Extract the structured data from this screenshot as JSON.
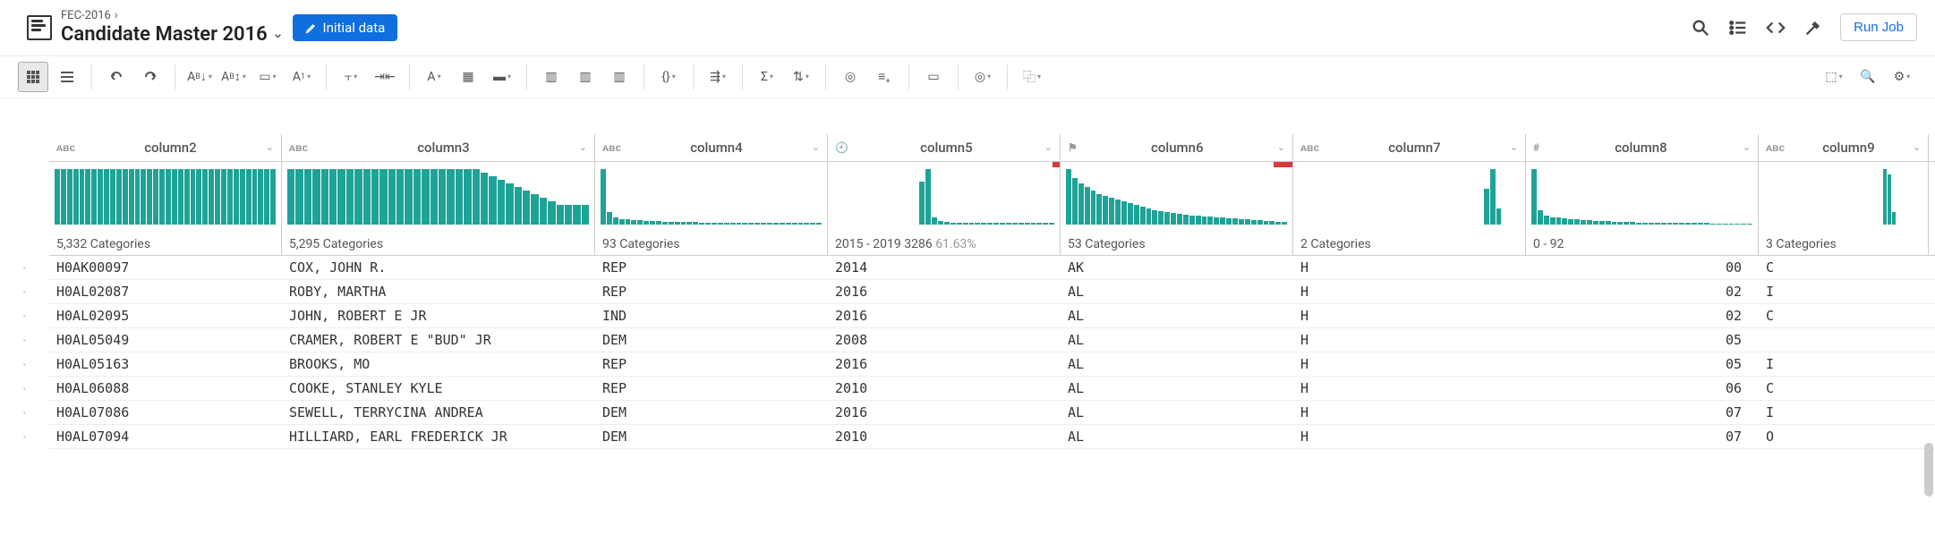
{
  "breadcrumb": {
    "parent": "FEC-2016",
    "title": "Candidate Master 2016"
  },
  "badge": {
    "label": "Initial data"
  },
  "runjob": {
    "label": "Run Job"
  },
  "columns": [
    {
      "key": "c2",
      "name": "column2",
      "type": "ABC",
      "summary": "5,332 Categories"
    },
    {
      "key": "c3",
      "name": "column3",
      "type": "ABC",
      "summary": "5,295 Categories"
    },
    {
      "key": "c4",
      "name": "column4",
      "type": "ABC",
      "summary": "93 Categories"
    },
    {
      "key": "c5",
      "name": "column5",
      "type": "TIME",
      "summary": "2015 - 2019  3286",
      "pct": "61.63%"
    },
    {
      "key": "c6",
      "name": "column6",
      "type": "FLAG",
      "summary": "53 Categories"
    },
    {
      "key": "c7",
      "name": "column7",
      "type": "ABC",
      "summary": "2 Categories"
    },
    {
      "key": "c8",
      "name": "column8",
      "type": "NUM",
      "summary": "0 - 92"
    },
    {
      "key": "c9",
      "name": "column9",
      "type": "ABC",
      "summary": "3 Categories"
    }
  ],
  "rows": [
    {
      "c2": "H0AK00097",
      "c3": "COX, JOHN R.",
      "c4": "REP",
      "c5": "2014",
      "c6": "AK",
      "c7": "H",
      "c8": "00",
      "c9": "C"
    },
    {
      "c2": "H0AL02087",
      "c3": "ROBY, MARTHA",
      "c4": "REP",
      "c5": "2016",
      "c6": "AL",
      "c7": "H",
      "c8": "02",
      "c9": "I"
    },
    {
      "c2": "H0AL02095",
      "c3": "JOHN, ROBERT E JR",
      "c4": "IND",
      "c5": "2016",
      "c6": "AL",
      "c7": "H",
      "c8": "02",
      "c9": "C"
    },
    {
      "c2": "H0AL05049",
      "c3": "CRAMER, ROBERT E \"BUD\" JR",
      "c4": "DEM",
      "c5": "2008",
      "c6": "AL",
      "c7": "H",
      "c8": "05",
      "c9": ""
    },
    {
      "c2": "H0AL05163",
      "c3": "BROOKS, MO",
      "c4": "REP",
      "c5": "2016",
      "c6": "AL",
      "c7": "H",
      "c8": "05",
      "c9": "I"
    },
    {
      "c2": "H0AL06088",
      "c3": "COOKE, STANLEY KYLE",
      "c4": "REP",
      "c5": "2010",
      "c6": "AL",
      "c7": "H",
      "c8": "06",
      "c9": "C"
    },
    {
      "c2": "H0AL07086",
      "c3": "SEWELL, TERRYCINA ANDREA",
      "c4": "DEM",
      "c5": "2016",
      "c6": "AL",
      "c7": "H",
      "c8": "07",
      "c9": "I"
    },
    {
      "c2": "H0AL07094",
      "c3": "HILLIARD, EARL FREDERICK JR",
      "c4": "DEM",
      "c5": "2010",
      "c6": "AL",
      "c7": "H",
      "c8": "07",
      "c9": "O"
    }
  ],
  "chart_data": [
    {
      "column": "column2",
      "type": "bar",
      "note": "histogram of 5332 categories, roughly uniform",
      "values": [
        62,
        62,
        62,
        62,
        62,
        62,
        62,
        62,
        62,
        62,
        62,
        62,
        62,
        62,
        62,
        62,
        62,
        62,
        62,
        62,
        62,
        62,
        62,
        62,
        62,
        62,
        62,
        62,
        62,
        62,
        62,
        62,
        62,
        62,
        62,
        62
      ]
    },
    {
      "column": "column3",
      "type": "bar",
      "note": "histogram of 5295 categories, mostly uniform then tapering",
      "values": [
        62,
        62,
        62,
        62,
        62,
        62,
        62,
        62,
        62,
        62,
        62,
        62,
        62,
        62,
        62,
        62,
        62,
        62,
        62,
        62,
        62,
        62,
        62,
        58,
        54,
        50,
        46,
        42,
        38,
        34,
        30,
        26,
        22,
        22,
        22,
        22
      ]
    },
    {
      "column": "column4",
      "type": "bar",
      "note": "93 categories, one dominant then long tail",
      "values": [
        62,
        14,
        8,
        6,
        6,
        5,
        5,
        4,
        4,
        4,
        3,
        3,
        3,
        3,
        3,
        3,
        2,
        2,
        2,
        2,
        2,
        2,
        2,
        2,
        2,
        2,
        2,
        2,
        2,
        2,
        2,
        2,
        2,
        2,
        2,
        2
      ]
    },
    {
      "column": "column5",
      "type": "bar",
      "note": "years 2015-2019, two tall bars with small red invalid segment on right",
      "values": [
        0,
        0,
        0,
        0,
        0,
        0,
        0,
        0,
        0,
        0,
        0,
        0,
        0,
        0,
        48,
        62,
        8,
        4,
        3,
        2,
        2,
        2,
        2,
        2,
        2,
        2,
        2,
        2,
        2,
        2,
        2,
        2,
        2,
        2,
        2,
        2
      ],
      "invalid_fraction": 0.03
    },
    {
      "column": "column6",
      "type": "bar",
      "note": "53 categories descending with red invalid on right",
      "values": [
        62,
        52,
        46,
        42,
        38,
        34,
        32,
        30,
        28,
        26,
        24,
        22,
        20,
        18,
        16,
        15,
        14,
        13,
        12,
        11,
        10,
        10,
        9,
        9,
        8,
        8,
        7,
        7,
        6,
        6,
        5,
        5,
        4,
        4,
        3,
        3
      ],
      "invalid_fraction": 0.08
    },
    {
      "column": "column7",
      "type": "bar",
      "note": "2 categories",
      "values": [
        0,
        0,
        0,
        0,
        0,
        0,
        0,
        0,
        0,
        0,
        0,
        0,
        0,
        0,
        0,
        0,
        0,
        0,
        0,
        0,
        0,
        0,
        0,
        0,
        0,
        0,
        0,
        0,
        0,
        0,
        40,
        62,
        18,
        0,
        0,
        0
      ]
    },
    {
      "column": "column8",
      "type": "bar",
      "note": "numeric 0-92, spike at low end",
      "values": [
        62,
        16,
        10,
        8,
        8,
        7,
        6,
        6,
        5,
        5,
        4,
        4,
        4,
        3,
        3,
        3,
        3,
        2,
        2,
        2,
        2,
        2,
        2,
        2,
        2,
        2,
        2,
        2,
        2,
        1,
        1,
        1,
        1,
        1,
        1,
        1
      ]
    },
    {
      "column": "column9",
      "type": "bar",
      "note": "3 categories",
      "values": [
        0,
        0,
        0,
        0,
        0,
        0,
        0,
        0,
        0,
        0,
        0,
        0,
        0,
        0,
        0,
        0,
        0,
        0,
        0,
        0,
        0,
        0,
        0,
        0,
        0,
        0,
        0,
        62,
        56,
        14,
        0,
        0,
        0,
        0,
        0,
        0
      ]
    }
  ]
}
